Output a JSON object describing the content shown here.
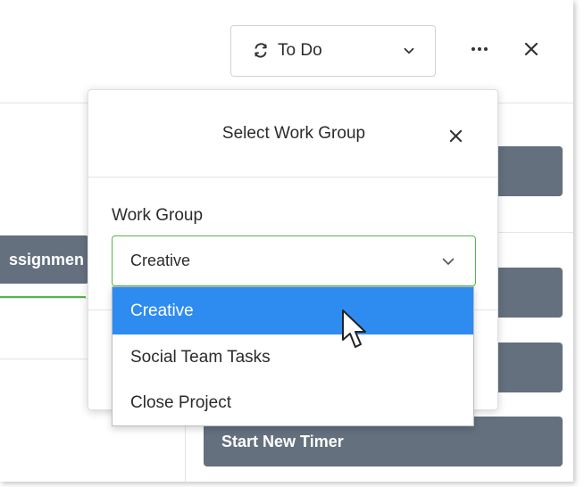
{
  "topbar": {
    "status_label": "To Do",
    "status_icon": "sync-icon",
    "more_icon": "more-horizontal-icon",
    "close_icon": "close-icon"
  },
  "background": {
    "assignments_label": "ssignmen",
    "start_timer_label": "Start New Timer"
  },
  "modal": {
    "title": "Select Work Group",
    "field_label": "Work Group",
    "selected_value": "Creative",
    "options": [
      {
        "label": "Creative",
        "selected": true
      },
      {
        "label": "Social Team Tasks",
        "selected": false
      },
      {
        "label": "Close Project",
        "selected": false
      }
    ]
  },
  "colors": {
    "accent_green": "#52b848",
    "selected_blue": "#2e8cf0",
    "slate_button": "#64707e"
  }
}
